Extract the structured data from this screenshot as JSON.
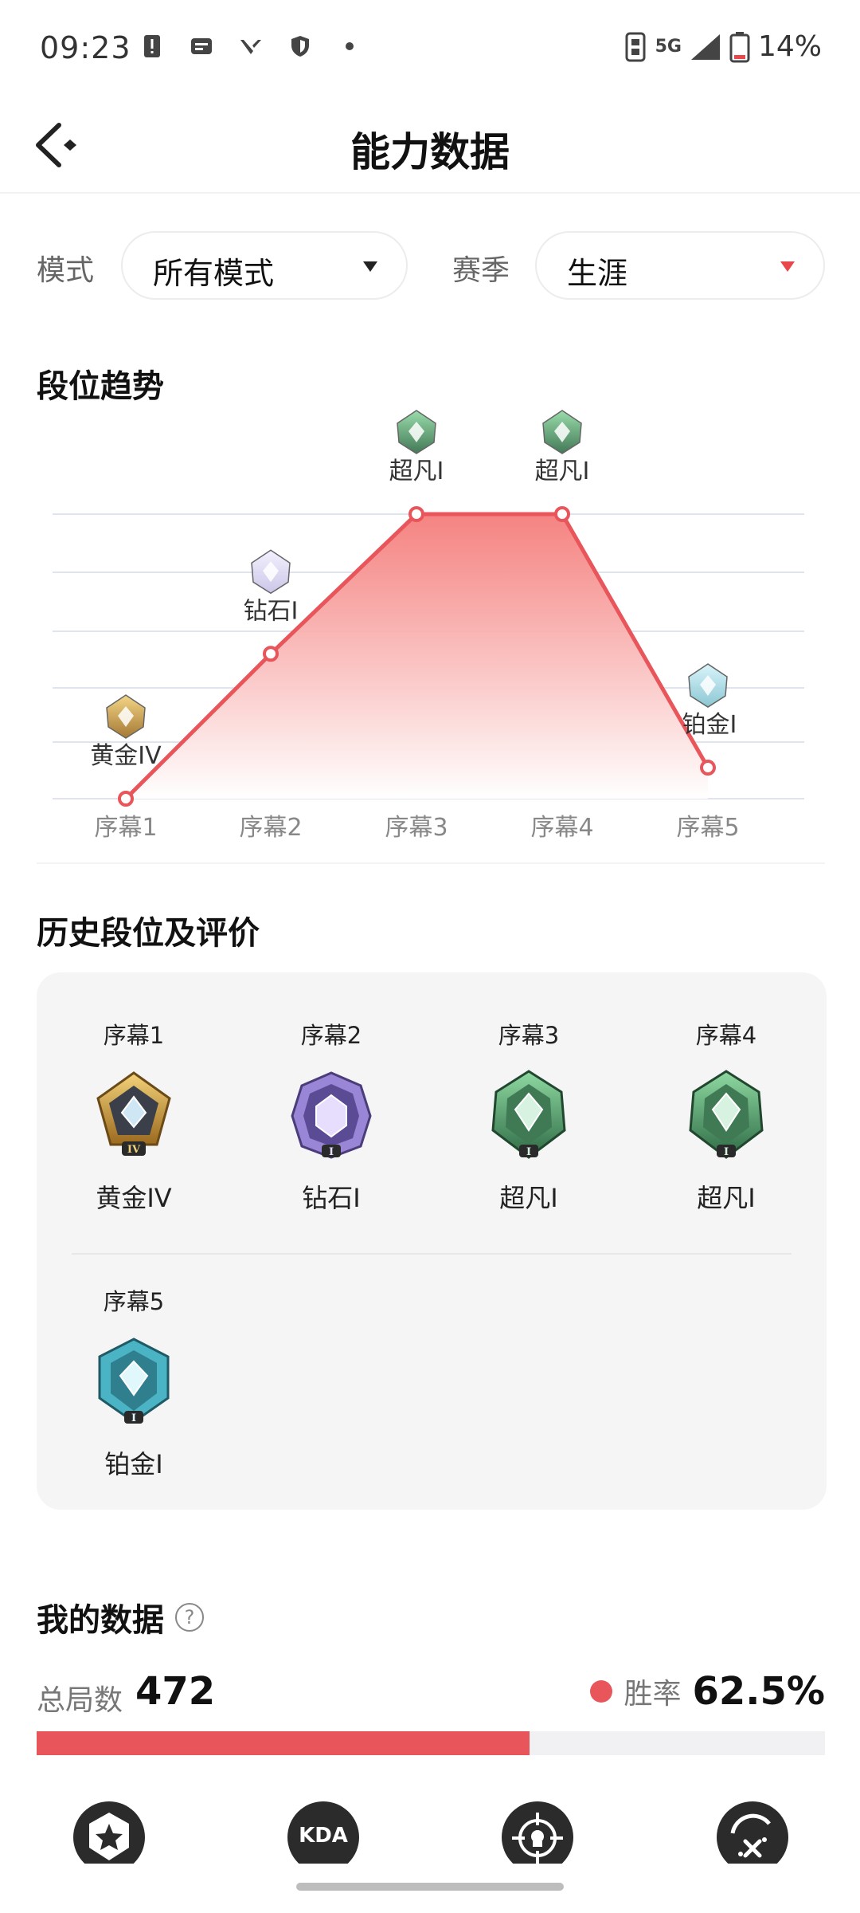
{
  "status_bar": {
    "time": "09:23",
    "network": "5G",
    "battery": "14%"
  },
  "header": {
    "title": "能力数据"
  },
  "filters": {
    "mode_label": "模式",
    "mode_value": "所有模式",
    "season_label": "赛季",
    "season_value": "生涯"
  },
  "trend": {
    "title": "段位趋势"
  },
  "chart_data": {
    "type": "area",
    "categories": [
      "序幕1",
      "序幕2",
      "序幕3",
      "序幕4",
      "序幕5"
    ],
    "rank_labels": [
      "黄金IV",
      "钻石I",
      "超凡I",
      "超凡I",
      "铂金I"
    ],
    "values": [
      0,
      2.8,
      5.5,
      5.5,
      0.6
    ],
    "ylim": [
      0,
      5.5
    ],
    "grid": true,
    "colors": {
      "line": "#e8555a",
      "fill_top": "#f47d7b",
      "fill_bottom": "#ffffff",
      "grid": "#dfe4ee"
    }
  },
  "history": {
    "title": "历史段位及评价",
    "items": [
      {
        "season": "序幕1",
        "rank": "黄金IV",
        "badge": "gold-iv-badge",
        "tier": "IV"
      },
      {
        "season": "序幕2",
        "rank": "钻石I",
        "badge": "diamond-i-badge",
        "tier": "I"
      },
      {
        "season": "序幕3",
        "rank": "超凡I",
        "badge": "ascendant-i-badge",
        "tier": "I"
      },
      {
        "season": "序幕4",
        "rank": "超凡I",
        "badge": "ascendant-i-badge",
        "tier": "I"
      },
      {
        "season": "序幕5",
        "rank": "铂金I",
        "badge": "platinum-i-badge",
        "tier": "I"
      }
    ]
  },
  "my_data": {
    "title": "我的数据",
    "help_glyph": "?",
    "total_label": "总局数",
    "total_value": "472",
    "winrate_label": "胜率",
    "winrate_value": "62.5%",
    "winrate_fraction": 0.625
  },
  "tabs": [
    {
      "name": "star-tab",
      "icon": "star-icon"
    },
    {
      "name": "kda-tab",
      "icon": "kda-icon",
      "label": "KDA"
    },
    {
      "name": "crosshair-tab",
      "icon": "crosshair-icon"
    },
    {
      "name": "combat-tab",
      "icon": "combat-icon"
    }
  ]
}
